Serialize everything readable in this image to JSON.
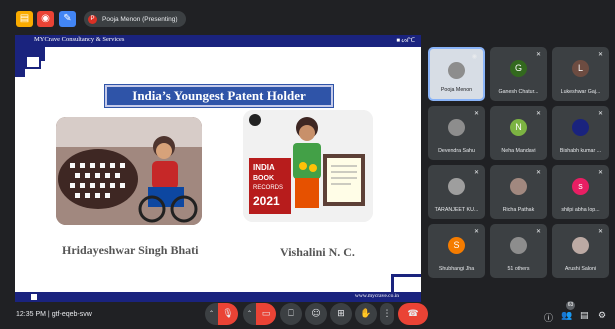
{
  "topbar": {
    "presenter_initial": "P",
    "presenter_label": "Pooja Menon (Presenting)",
    "icons": [
      "doc-icon",
      "record-icon",
      "pen-icon"
    ]
  },
  "slide": {
    "brand": "MYCrave Consultancy & Services",
    "logo_text": "■ ᔕᒋᑕ",
    "title": "India’s Youngest Patent Holder",
    "caption_left": "Hridayeshwar Singh Bhati",
    "caption_right": "Vishalini N. C.",
    "book_text": "INDIA BOOK OF RECORDS 2021",
    "footer_url": "www.mycrave.co.in"
  },
  "participants": [
    {
      "name": "Pooja Menon",
      "initial": "",
      "color": "#8d8d8d",
      "active": true
    },
    {
      "name": "Ganesh Chatur...",
      "initial": "G",
      "color": "#33691e"
    },
    {
      "name": "Lukeshwar Gaj...",
      "initial": "L",
      "color": "#6d4c41"
    },
    {
      "name": "Devendra Sahu",
      "initial": "",
      "color": "#8d8d8d"
    },
    {
      "name": "Neha Mandavi",
      "initial": "N",
      "color": "#7cb342"
    },
    {
      "name": "Bishabh kumar ...",
      "initial": "",
      "color": "#1a237e"
    },
    {
      "name": "TARANJEET KU...",
      "initial": "",
      "color": "#9e9e9e"
    },
    {
      "name": "Richa Pathak",
      "initial": "",
      "color": "#a1887f"
    },
    {
      "name": "shilpi abha lop...",
      "initial": "s",
      "color": "#e91e63"
    },
    {
      "name": "Shubhangi Jha",
      "initial": "S",
      "color": "#f57c00"
    },
    {
      "name": "51 others",
      "initial": "",
      "color": "#8d8d8d"
    },
    {
      "name": "Arushi Saloni",
      "initial": "",
      "color": "#bcaaa4"
    }
  ],
  "bottom": {
    "time": "12:35 PM",
    "separator": "|",
    "meeting_code": "gtf-eqeb-svw",
    "people_count": "63"
  }
}
